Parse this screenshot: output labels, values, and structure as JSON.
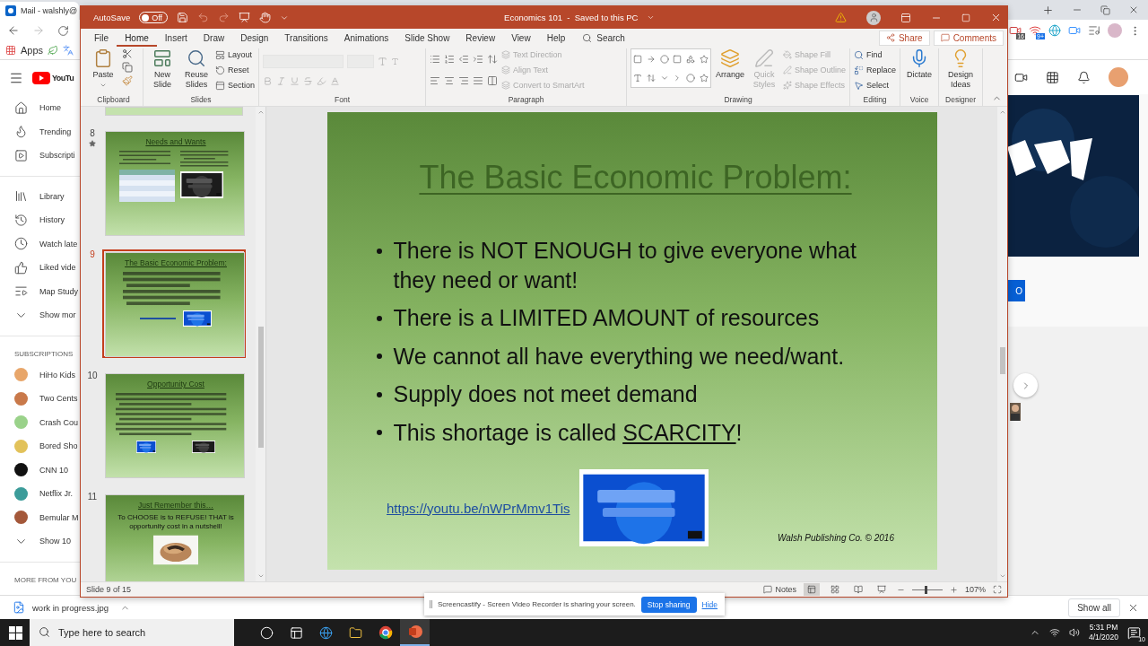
{
  "browser": {
    "tab_title": "Mail - walshly@",
    "bookmark": "Apps",
    "badges": [
      "16",
      "9+"
    ]
  },
  "youtube": {
    "logo": "YouTu",
    "nav": [
      {
        "label": "Home"
      },
      {
        "label": "Trending"
      },
      {
        "label": "Subscripti"
      }
    ],
    "library": [
      {
        "label": "Library"
      },
      {
        "label": "History"
      },
      {
        "label": "Watch late"
      },
      {
        "label": "Liked vide"
      },
      {
        "label": "Map Study"
      },
      {
        "label": "Show mor"
      }
    ],
    "subscriptions_heading": "SUBSCRIPTIONS",
    "subscriptions": [
      {
        "label": "HiHo Kids",
        "color": "#e8a66a"
      },
      {
        "label": "Two Cents",
        "color": "#c9794a"
      },
      {
        "label": "Crash Cou",
        "color": "#9ad28a"
      },
      {
        "label": "Bored Sho",
        "color": "#e2c25a"
      },
      {
        "label": "CNN 10",
        "color": "#111111"
      },
      {
        "label": "Netflix Jr.",
        "color": "#3c9c9a"
      },
      {
        "label": "Bemular M",
        "color": "#a4583a"
      }
    ],
    "show_more": "Show 10",
    "more_heading": "MORE FROM YOU",
    "side_button": "O"
  },
  "ppt": {
    "autosave": {
      "label": "AutoSave",
      "state": "Off",
      "on": false
    },
    "window_title": "Economics 101  -  Saved to this PC",
    "tabs": [
      {
        "label": "File",
        "selected": false
      },
      {
        "label": "Home",
        "selected": true
      },
      {
        "label": "Insert",
        "selected": false
      },
      {
        "label": "Draw",
        "selected": false
      },
      {
        "label": "Design",
        "selected": false
      },
      {
        "label": "Transitions",
        "selected": false
      },
      {
        "label": "Animations",
        "selected": false
      },
      {
        "label": "Slide Show",
        "selected": false
      },
      {
        "label": "Review",
        "selected": false
      },
      {
        "label": "View",
        "selected": false
      },
      {
        "label": "Help",
        "selected": false
      }
    ],
    "search": "Search",
    "share": "Share",
    "comments": "Comments",
    "ribbon": {
      "clipboard": {
        "label": "Clipboard",
        "paste": "Paste"
      },
      "slides": {
        "label": "Slides",
        "new_slide": "New Slide",
        "reuse_slides": "Reuse Slides",
        "commands": [
          {
            "label": "Layout"
          },
          {
            "label": "Reset"
          },
          {
            "label": "Section"
          }
        ]
      },
      "font": {
        "label": "Font",
        "disabled": true
      },
      "paragraph": {
        "label": "Paragraph",
        "commands": [
          {
            "label": "Text Direction",
            "disabled": true
          },
          {
            "label": "Align Text",
            "disabled": true
          },
          {
            "label": "Convert to SmartArt",
            "disabled": true
          }
        ]
      },
      "drawing": {
        "label": "Drawing",
        "arrange": "Arrange",
        "quick_styles": {
          "label": "Quick Styles",
          "disabled": true
        },
        "commands": [
          {
            "label": "Shape Fill",
            "disabled": true
          },
          {
            "label": "Shape Outline",
            "disabled": true
          },
          {
            "label": "Shape Effects",
            "disabled": true
          }
        ]
      },
      "editing": {
        "label": "Editing",
        "commands": [
          {
            "label": "Find"
          },
          {
            "label": "Replace"
          },
          {
            "label": "Select"
          }
        ]
      },
      "voice": {
        "label": "Voice",
        "button": "Dictate"
      },
      "designer": {
        "label": "Designer",
        "button": "Design Ideas"
      }
    },
    "thumbnails": [
      {
        "number": "8",
        "starred": true,
        "selected": false,
        "kind": "two_column",
        "title": "Needs and Wants"
      },
      {
        "number": "9",
        "starred": false,
        "selected": true,
        "kind": "bullets",
        "title": "The Basic Economic Problem:"
      },
      {
        "number": "10",
        "starred": false,
        "selected": false,
        "kind": "notes",
        "title": "Opportunity Cost"
      },
      {
        "number": "11",
        "starred": false,
        "selected": false,
        "kind": "quote",
        "title": "Just Remember this…",
        "quote": "To CHOOSE is to REFUSE!  THAT is opportunity cost in a nutshell!"
      }
    ],
    "slide": {
      "kind": "bullets",
      "title": "The Basic Economic Problem:",
      "bullets": [
        [
          {
            "text": "There is NOT ENOUGH to give everyone what they need or want!"
          }
        ],
        [
          {
            "text": "There is a LIMITED AMOUNT of resources"
          }
        ],
        [
          {
            "text": "We cannot all have everything we need/want."
          }
        ],
        [
          {
            "text": "Supply does not meet demand"
          }
        ],
        [
          {
            "text": "This shortage is called "
          },
          {
            "text": "SCARCITY",
            "underline": true
          },
          {
            "text": "!"
          }
        ]
      ],
      "link": "https://youtu.be/nWPrMmv1Tis",
      "footer": "Walsh Publishing Co. © 2016"
    },
    "status": {
      "slide_counter": "Slide 9 of 15",
      "notes": "Notes",
      "views": [
        {
          "selected": true
        },
        {
          "selected": false
        },
        {
          "selected": false
        },
        {
          "selected": false
        }
      ],
      "zoom": {
        "level": 0.4,
        "reading": "107%"
      }
    }
  },
  "screencastify": {
    "message": "Screencastify - Screen Video Recorder is sharing your screen.",
    "stop": "Stop sharing",
    "hide": "Hide"
  },
  "downloads": {
    "file": "work in progress.jpg",
    "show_all": "Show all"
  },
  "taskbar": {
    "search_placeholder": "Type here to search",
    "apps": [
      {
        "selected": false
      },
      {
        "selected": false
      },
      {
        "selected": false
      },
      {
        "selected": false
      },
      {
        "selected": false
      },
      {
        "selected": true
      }
    ],
    "time": "5:31 PM",
    "date": "4/1/2020",
    "notifications": "10"
  }
}
